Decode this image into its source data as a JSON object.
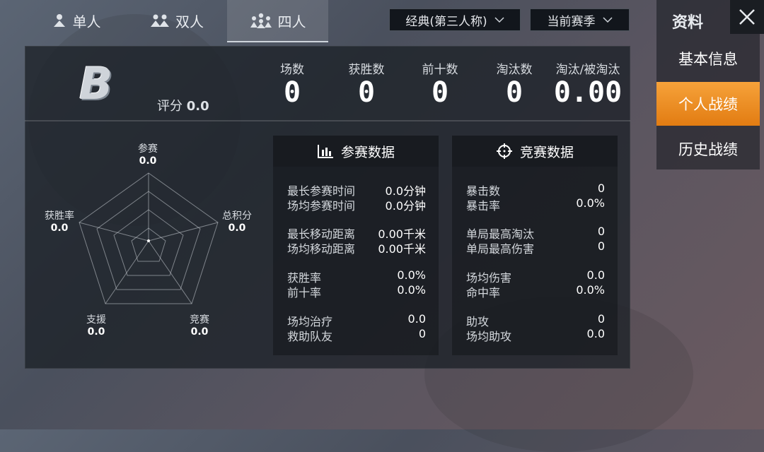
{
  "mode_tabs": [
    {
      "label": "单人",
      "icon": "single-person-icon"
    },
    {
      "label": "双人",
      "icon": "duo-icon"
    },
    {
      "label": "四人",
      "icon": "squad-icon"
    }
  ],
  "filters": {
    "mode": "经典(第三人称)",
    "season": "当前赛季"
  },
  "sidebar": {
    "title": "资料",
    "items": [
      {
        "label": "基本信息"
      },
      {
        "label": "个人战绩"
      },
      {
        "label": "历史战绩"
      }
    ],
    "active_index": 1
  },
  "summary": {
    "grade": "B",
    "score_label": "评分",
    "score_value": "0.0",
    "stats": [
      {
        "label": "场数",
        "value": "0"
      },
      {
        "label": "获胜数",
        "value": "0"
      },
      {
        "label": "前十数",
        "value": "0"
      },
      {
        "label": "淘汰数",
        "value": "0"
      },
      {
        "label": "淘汰/被淘汰",
        "value": "0.00"
      }
    ]
  },
  "radar": {
    "axes": [
      {
        "label": "参赛",
        "value": "0.0"
      },
      {
        "label": "总积分",
        "value": "0.0"
      },
      {
        "label": "竞赛",
        "value": "0.0"
      },
      {
        "label": "支援",
        "value": "0.0"
      },
      {
        "label": "获胜率",
        "value": "0.0"
      }
    ]
  },
  "participation": {
    "title": "参赛数据",
    "rows": [
      {
        "label": "最长参赛时间",
        "value": "0.0分钟"
      },
      {
        "label": "场均参赛时间",
        "value": "0.0分钟"
      },
      {
        "label": "最长移动距离",
        "value": "0.00千米"
      },
      {
        "label": "场均移动距离",
        "value": "0.00千米"
      },
      {
        "label": "获胜率",
        "value": "0.0%"
      },
      {
        "label": "前十率",
        "value": "0.0%"
      },
      {
        "label": "场均治疗",
        "value": "0.0"
      },
      {
        "label": "救助队友",
        "value": "0"
      }
    ]
  },
  "competition": {
    "title": "竞赛数据",
    "rows": [
      {
        "label": "暴击数",
        "value": "0"
      },
      {
        "label": "暴击率",
        "value": "0.0%"
      },
      {
        "label": "单局最高淘汰",
        "value": "0"
      },
      {
        "label": "单局最高伤害",
        "value": "0"
      },
      {
        "label": "场均伤害",
        "value": "0.0"
      },
      {
        "label": "命中率",
        "value": "0.0%"
      },
      {
        "label": "助攻",
        "value": "0"
      },
      {
        "label": "场均助攻",
        "value": "0.0"
      }
    ]
  },
  "colors": {
    "accent": "#f08c1e",
    "panel": "#1c2128"
  }
}
